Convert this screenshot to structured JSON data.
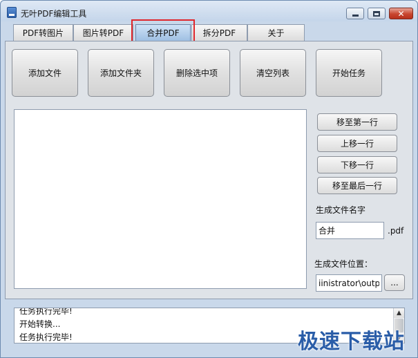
{
  "window": {
    "title": "无叶PDF编辑工具",
    "controls": {
      "minimize_icon": "minimize-icon",
      "maximize_icon": "maximize-icon",
      "close_icon": "close-icon"
    }
  },
  "tabs": [
    {
      "label": "PDF转图片",
      "active": false
    },
    {
      "label": "图片转PDF",
      "active": false
    },
    {
      "label": "合并PDF",
      "active": true
    },
    {
      "label": "拆分PDF",
      "active": false
    },
    {
      "label": "关于",
      "active": false
    }
  ],
  "toolbar": {
    "add_file": "添加文件",
    "add_folder": "添加文件夹",
    "delete_selected": "删除选中项",
    "clear_list": "清空列表",
    "start_task": "开始任务"
  },
  "file_list": {
    "items": []
  },
  "order_buttons": {
    "move_to_top": "移至第一行",
    "move_up": "上移一行",
    "move_down": "下移一行",
    "move_to_bottom": "移至最后一行"
  },
  "output": {
    "name_label": "生成文件名字",
    "name_value": "合并",
    "extension": ".pdf",
    "location_label": "生成文件位置：",
    "location_value": "iinistrator\\output",
    "browse_label": "..."
  },
  "log": {
    "lines": [
      "任务执行完毕!",
      "开始转换...",
      "任务执行完毕!"
    ],
    "scroll_up": "▲",
    "scroll_down": "▼"
  },
  "watermark": "极速下载站",
  "colors": {
    "highlight": "#e0262b",
    "active_tab": "#9fbfe2",
    "watermark": "#2a5da8"
  }
}
